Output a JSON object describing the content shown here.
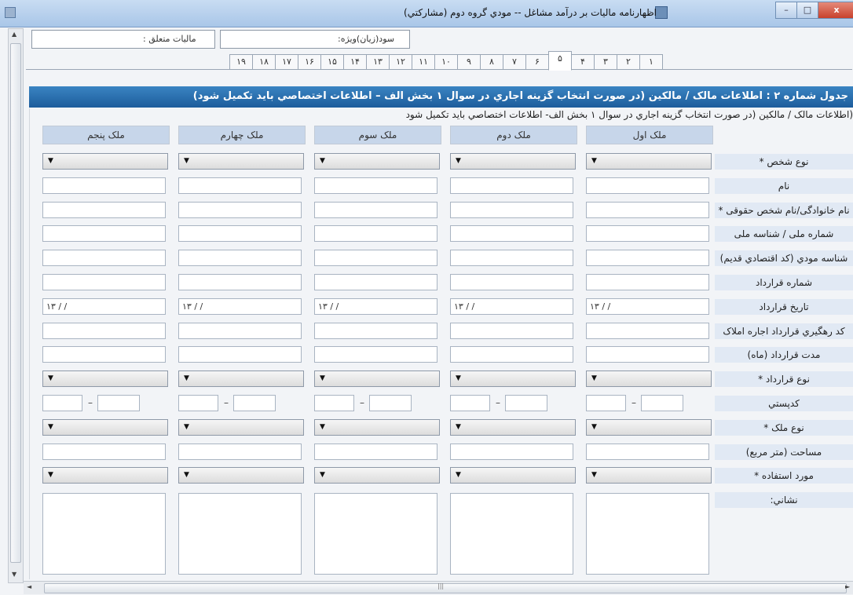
{
  "window": {
    "title": "اظهارنامه ماليات بر درآمد مشاغل --  مودي گروه دوم (مشاركتي)",
    "buttons": {
      "minimize": "–",
      "maximize": "□",
      "close": "x"
    }
  },
  "header": {
    "tax_label": "ماليات متعلق :",
    "profit_label": "سود(زيان)ويژه:"
  },
  "tabs": [
    "۱",
    "۲",
    "۳",
    "۴",
    "۵",
    "۶",
    "۷",
    "۸",
    "۹",
    "۱۰",
    "۱۱",
    "۱۲",
    "۱۳",
    "۱۴",
    "۱۵",
    "۱۶",
    "۱۷",
    "۱۸",
    "۱۹"
  ],
  "active_tab": "۵",
  "table": {
    "title": "جدول شماره ۲ : اطلاعات مالک / مالکين (در صورت انتخاب گزينه اجاري در سوال ۱ بخش الف – اطلاعات اختصاصي بايد تکميل شود)",
    "note": "(اطلاعات مالک / مالکين (در صورت انتخاب گزينه اجاري در سوال ۱ بخش الف- اطلاعات اختصاصي بايد تکميل شود",
    "columns": [
      "ملک اول",
      "ملک دوم",
      "ملک سوم",
      "ملک چهارم",
      "ملک پنجم"
    ],
    "rows": [
      {
        "label": "نوع شخص *",
        "type": "select"
      },
      {
        "label": "نام",
        "type": "text"
      },
      {
        "label": "نام خانوادگی/نام شخص حقوقی *",
        "type": "text"
      },
      {
        "label": "شماره ملی / شناسه ملی",
        "type": "text"
      },
      {
        "label": "شناسه مودي (کد اقتصادي قديم)",
        "type": "text"
      },
      {
        "label": "شماره قرارداد",
        "type": "text"
      },
      {
        "label": "تاريخ قرارداد",
        "type": "date"
      },
      {
        "label": "کد رهگيري قرارداد اجاره املاک",
        "type": "text"
      },
      {
        "label": "مدت قرارداد (ماه)",
        "type": "text"
      },
      {
        "label": "نوع قرارداد *",
        "type": "select"
      },
      {
        "label": "کدپستي",
        "type": "postal"
      },
      {
        "label": "نوع ملک *",
        "type": "select"
      },
      {
        "label": "مساحت (متر مربع)",
        "type": "text"
      },
      {
        "label": "مورد استفاده *",
        "type": "select"
      },
      {
        "label": "نشاني:",
        "type": "area"
      }
    ],
    "date_placeholder": "۱۳ / /",
    "postal_separator": "–"
  },
  "scroll": {
    "up": "▲",
    "down": "▼",
    "left": "◄",
    "right": "►",
    "grip": "|||"
  },
  "select_arrow": "▼"
}
